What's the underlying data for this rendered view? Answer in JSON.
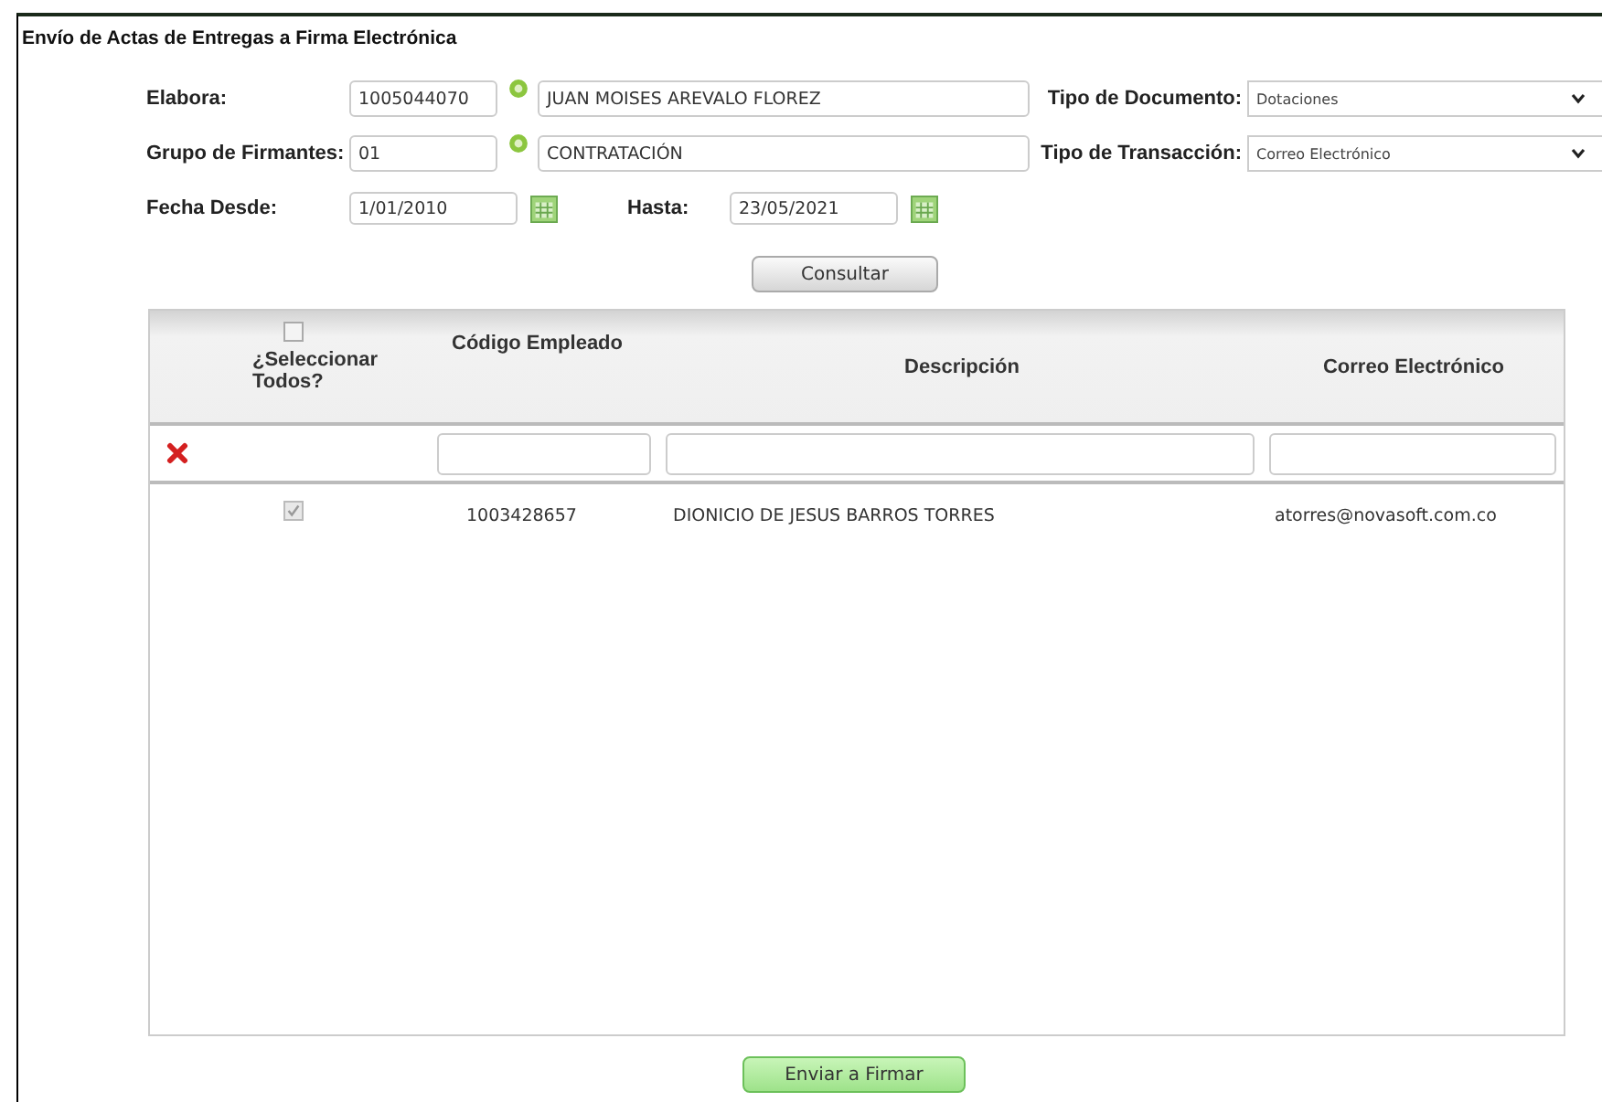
{
  "window": {
    "title": "Envío de Actas de Entregas a Firma Electrónica"
  },
  "form": {
    "elabora": {
      "label": "Elabora:",
      "code": "1005044070",
      "name": "JUAN MOISES AREVALO FLOREZ"
    },
    "grupo": {
      "label": "Grupo de Firmantes:",
      "code": "01",
      "name": "CONTRATACIÓN"
    },
    "tipo_documento": {
      "label": "Tipo de Documento:",
      "value": "Dotaciones"
    },
    "tipo_transaccion": {
      "label": "Tipo de Transacción:",
      "value": "Correo Electrónico"
    },
    "fecha_desde": {
      "label": "Fecha Desde:",
      "value": "1/01/2010"
    },
    "hasta": {
      "label": "Hasta:",
      "value": "23/05/2021"
    },
    "consultar_button": "Consultar"
  },
  "table": {
    "select_all": {
      "label": "¿Seleccionar Todos?",
      "checked": false
    },
    "columns": [
      "Código Empleado",
      "Descripción",
      "Correo Electrónico"
    ],
    "rows": [
      {
        "selected": true,
        "disabled": true,
        "code": "1003428657",
        "description": "DIONICIO DE JESUS BARROS TORRES",
        "email": "atorres@novasoft.com.co"
      }
    ]
  },
  "send_button": "Enviar a Firmar"
}
